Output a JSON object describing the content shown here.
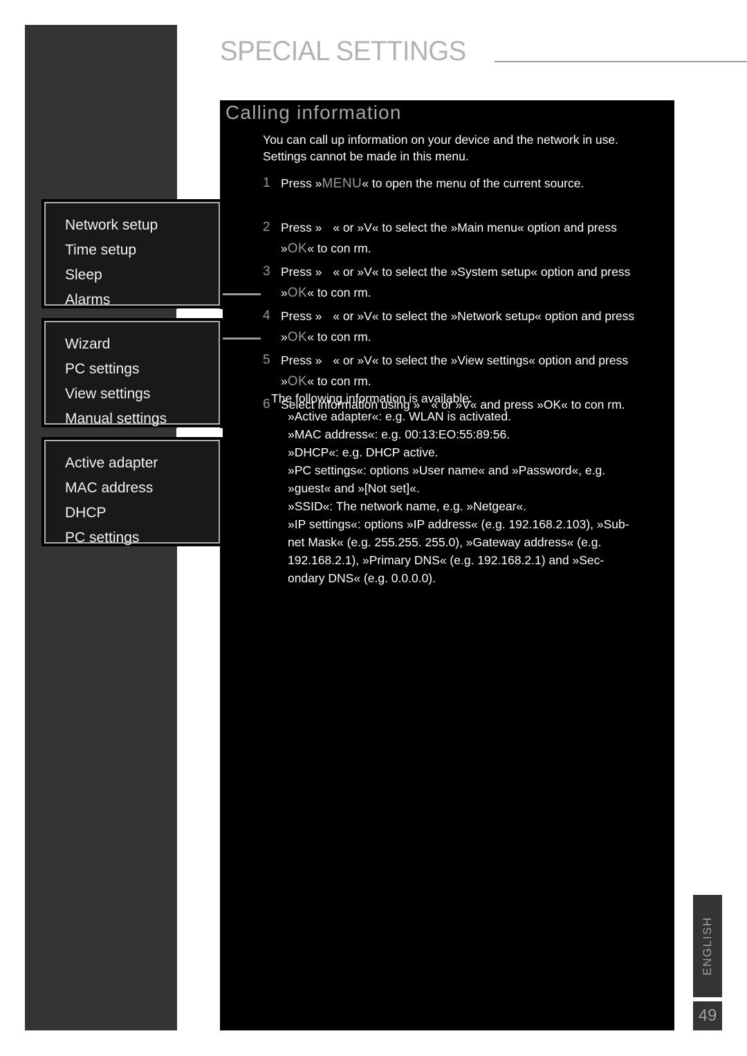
{
  "header": {
    "title": "SPECIAL SETTINGS"
  },
  "section": {
    "heading": "Calling information",
    "intro_line_1": "You can call up information on your device and the network in use.",
    "intro_line_2": "Settings cannot be made in this menu."
  },
  "steps": [
    {
      "num": "1",
      "line_1_a": "Press »",
      "line_1_key": "MENU",
      "line_1_b": "« to open the menu of the current source.",
      "line_2": ""
    },
    {
      "num": "2",
      "line_1_a": "Press »",
      "line_1_key": "",
      "line_1_b": "« or »V« to select the »Main menu« option and press",
      "line_2_a": "»",
      "line_2_key": "OK",
      "line_2_b": "« to con rm."
    },
    {
      "num": "3",
      "line_1_a": "Press »",
      "line_1_key": "",
      "line_1_b": "« or »V« to select the »System setup« option and press",
      "line_2_a": "»",
      "line_2_key": "OK",
      "line_2_b": "« to con rm."
    },
    {
      "num": "4",
      "line_1_a": "Press »",
      "line_1_key": "",
      "line_1_b": "« or »V« to select the »Network setup« option and press",
      "line_2_a": "»",
      "line_2_key": "OK",
      "line_2_b": "« to con rm."
    },
    {
      "num": "5",
      "line_1_a": "Press »",
      "line_1_key": "",
      "line_1_b": "« or »V« to select the »View settings« option and press",
      "line_2_a": "»",
      "line_2_key": "OK",
      "line_2_b": "« to con rm."
    },
    {
      "num": "6",
      "line_1_a": "Select information using »",
      "line_1_key": "",
      "line_1_b": "« or »V« and press »OK« to con rm.",
      "line_2": ""
    }
  ],
  "sublist": {
    "intro": "The following information is available:",
    "items": [
      "»Active adapter«: e.g. WLAN  is activated.",
      "»MAC address«: e.g. 00:13:EO:55:89:56.",
      "»DHCP«: e.g. DHCP active.",
      "»PC settings«: options »User name« and »Password«, e.g.",
      "»guest« and »[Not set]«.",
      "»SSID«: The network name, e.g. »Netgear«.",
      "»IP settings«: options »IP address« (e.g. 192.168.2.103), »Sub-",
      "net Mask« (e.g. 255.255. 255.0), »Gateway address« (e.g.",
      "192.168.2.1), »Primary DNS« (e.g. 192.168.2.1) and »Sec-",
      "ondary DNS« (e.g. 0.0.0.0)."
    ]
  },
  "osd_menus": [
    {
      "name": "system-setup-menu",
      "rows": [
        "Network setup",
        "Time setup",
        "Sleep",
        "Alarms"
      ]
    },
    {
      "name": "network-setup-menu",
      "rows": [
        "Wizard",
        "PC settings",
        "View settings",
        "Manual settings"
      ]
    },
    {
      "name": "view-settings-menu",
      "rows": [
        "Active adapter",
        "MAC address",
        "DHCP",
        "PC settings"
      ]
    }
  ],
  "footer": {
    "language": "ENGLISH",
    "page_number": "49"
  },
  "colors": {
    "rail": "#343434",
    "panel": "#000000",
    "heading": "#a5a5a5",
    "key": "#9a9a9a",
    "osd_border": "#b0b0b0",
    "osd_bg": "#191919"
  }
}
